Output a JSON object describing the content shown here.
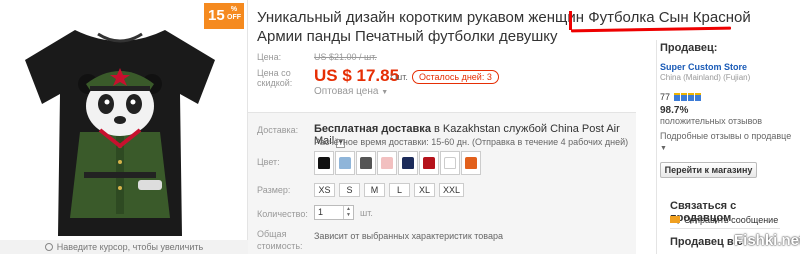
{
  "discount": {
    "value": "15",
    "pct": "%",
    "off": "OFF"
  },
  "image": {
    "zoom_hint": "Наведите курсор, чтобы увеличить"
  },
  "title": "Уникальный дизайн коротким рукавом женщин Футболка Сын Красной Армии панды Печатный футболки девушку",
  "price": {
    "old_label": "Цена:",
    "old_value": "US $21.00 / шт.",
    "sale_label_1": "Цена со",
    "sale_label_2": "скидкой:",
    "sale_value": "US $ 17.85",
    "per_unit": "/ шт.",
    "days_left": "Осталось дней: 3",
    "wholesale": "Оптовая цена"
  },
  "shipping": {
    "label": "Доставка:",
    "free": "Бесплатная доставка",
    "rest": " в Kazakhstan службой China Post Air Mail",
    "estimate": "Расчётное время доставки: 15-60 дн. (Отправка в течение 4 рабочих дней)"
  },
  "color": {
    "label": "Цвет:",
    "swatches": [
      "#111111",
      "#8fb5d9",
      "#555555",
      "#f2c0c0",
      "#1c2b5a",
      "#b5121b",
      "#ffffff",
      "#e2601c"
    ]
  },
  "size": {
    "label": "Размер:",
    "options": [
      "XS",
      "S",
      "M",
      "L",
      "XL",
      "XXL"
    ]
  },
  "quantity": {
    "label": "Количество:",
    "value": "1",
    "unit": "шт."
  },
  "total": {
    "label_1": "Общая",
    "label_2": "стоимость:",
    "note": "Зависит от выбранных характеристик товара"
  },
  "seller": {
    "header": "Продавец:",
    "store": "Super Custom Store",
    "region": "China (Mainland) (Fujian)",
    "score": "77",
    "positive": "98.7%",
    "positive_label": "положительных отзывов",
    "details": "Подробные отзывы о продавце",
    "store_button": "Перейти к магазину",
    "contact_header": "Связаться с продавцом",
    "send_message": "Отправить сообщение",
    "seller_in": "Продавец в с"
  },
  "watermark": "Fishki.net",
  "colors": {
    "accent": "#e62e04",
    "discount_badge": "#f58a1f",
    "link": "#1a5bb7",
    "annotation": "#ee0000"
  }
}
